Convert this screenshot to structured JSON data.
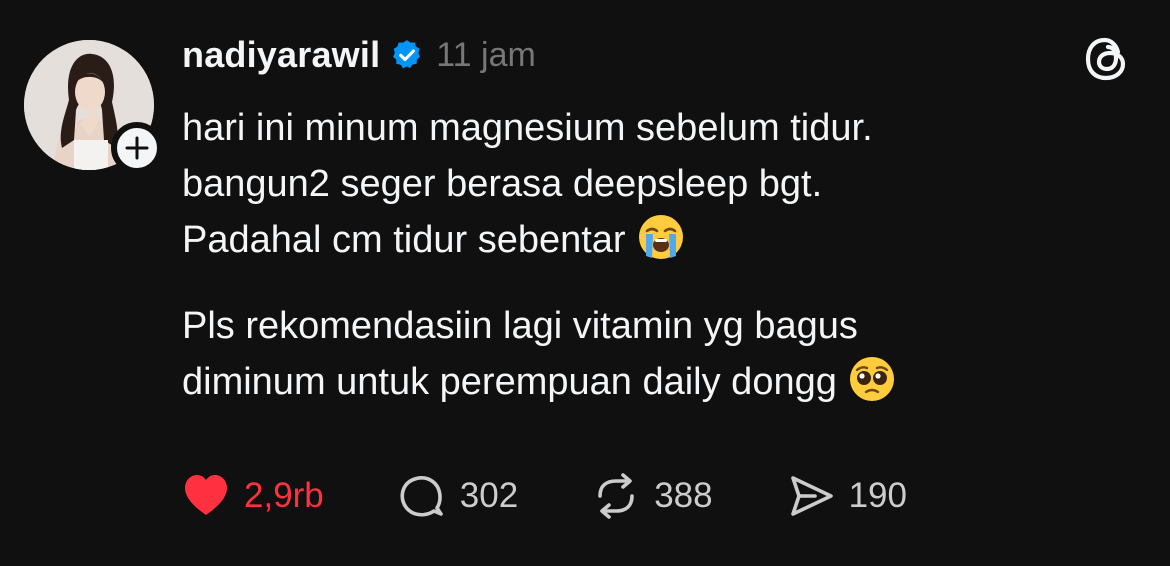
{
  "post": {
    "username": "nadiyarawil",
    "time": "11 jam",
    "verified": true,
    "paragraphs": [
      "hari ini minum magnesium sebelum tidur.\nbangun2 seger berasa deepsleep bgt.\nPadahal cm tidur sebentar",
      "Pls rekomendasiin lagi vitamin yg bagus\ndiminum untuk perempuan daily dongg"
    ],
    "emojis": [
      "loudly-crying-face",
      "pleading-face"
    ]
  },
  "actions": {
    "likes": "2,9rb",
    "replies": "302",
    "reposts": "388",
    "shares": "190"
  },
  "colors": {
    "background": "#101010",
    "text": "#f3f5f7",
    "muted": "#777777",
    "like": "#ff3040",
    "verified": "#0095f6"
  },
  "icons": [
    "threads-logo-icon",
    "verified-badge-icon",
    "plus-icon",
    "heart-icon",
    "comment-icon",
    "repost-icon",
    "share-icon"
  ]
}
